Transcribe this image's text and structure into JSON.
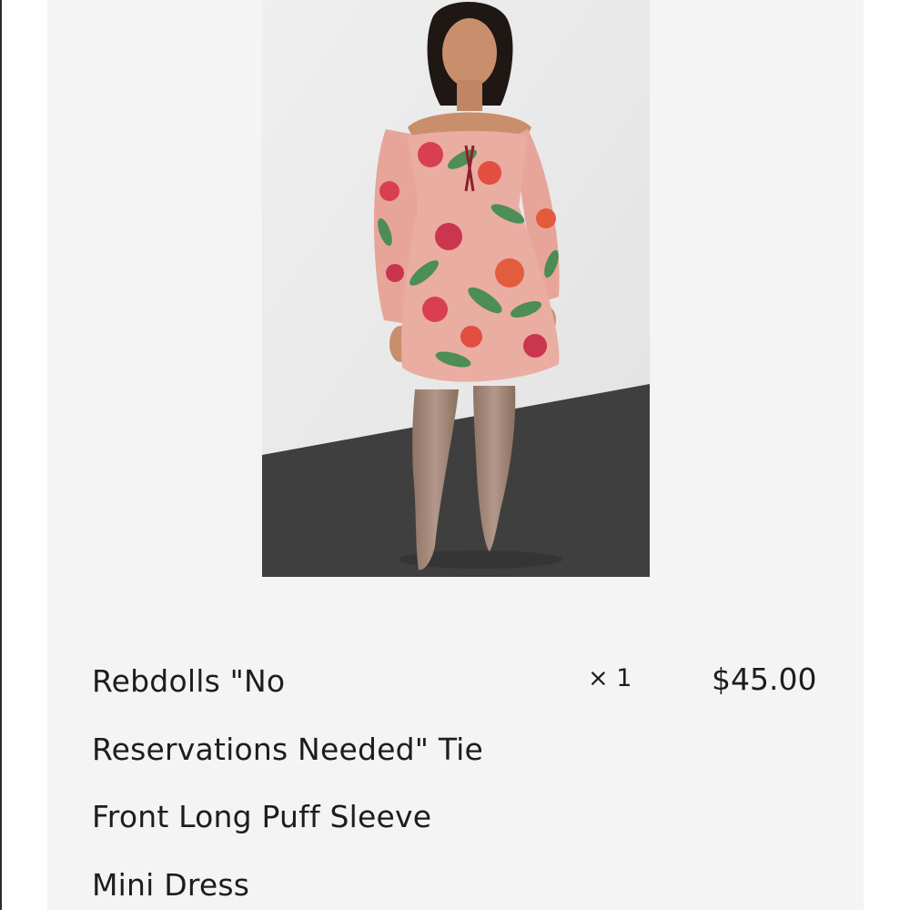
{
  "order_item": {
    "image_alt": "Model wearing floral long puff sleeve mini dress with tall taupe boots",
    "name_lines": [
      "Rebdolls \"No",
      "Reservations Needed\" Tie",
      "Front Long Puff Sleeve",
      "Mini Dress"
    ],
    "quantity": "× 1",
    "price": "$45.00"
  },
  "colors": {
    "panel_background": "#f4f4f4",
    "text": "#1d1d1d",
    "floor": "#3f3f3f"
  }
}
